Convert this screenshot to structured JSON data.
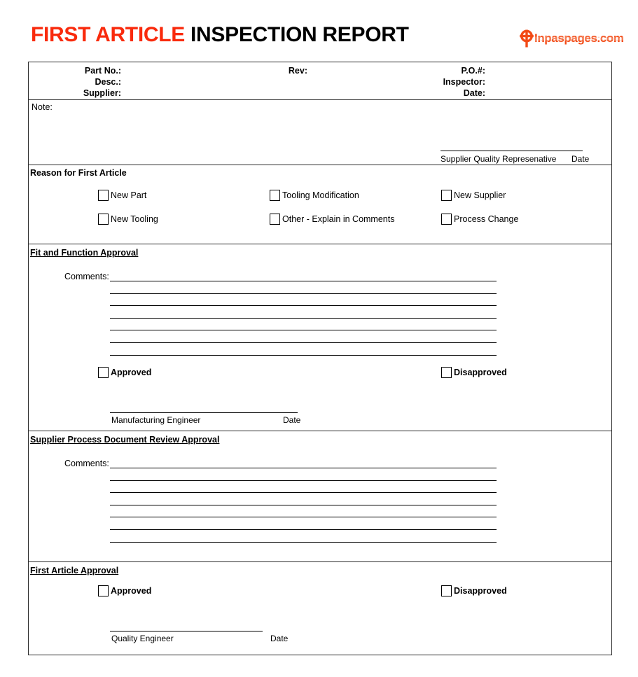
{
  "document": {
    "title_accent": "FIRST ARTICLE",
    "title_plain": " INSPECTION REPORT"
  },
  "logo": {
    "text": "Inpaspages.com",
    "mark": "celtic-cross-icon",
    "color": "#f24a16"
  },
  "header": {
    "fields": [
      {
        "label": "Part No.:"
      },
      {
        "label": "Rev:"
      },
      {
        "label": "P.O.#:"
      },
      {
        "label": "Desc.:"
      },
      {
        "label": "Inspector:"
      },
      {
        "label": "Supplier:"
      },
      {
        "label": "Date:"
      }
    ],
    "part_no": "Part No.:",
    "rev": "Rev:",
    "po": "P.O.#:",
    "desc": "Desc.:",
    "inspector": "Inspector:",
    "supplier": "Supplier:",
    "date": "Date:"
  },
  "note": {
    "label": "Note:",
    "signature_label": "Supplier Quality Represenative",
    "date_label": "Date"
  },
  "reason": {
    "title": "Reason for First Article",
    "options": [
      {
        "label": "New Part",
        "checked": false
      },
      {
        "label": "Tooling Modification",
        "checked": false
      },
      {
        "label": "New Supplier",
        "checked": false
      },
      {
        "label": "New Tooling",
        "checked": false
      },
      {
        "label": "Other - Explain in Comments",
        "checked": false
      },
      {
        "label": "Process Change",
        "checked": false
      }
    ]
  },
  "fit_function": {
    "title": "Fit and Function Approval",
    "comments_label": "Comments:",
    "comment_lines": 7,
    "approved_label": "Approved",
    "disapproved_label": "Disapproved",
    "approved_checked": false,
    "disapproved_checked": false,
    "signature_label": "Manufacturing Engineer",
    "date_label": "Date"
  },
  "supplier_process": {
    "title": "Supplier Process Document Review Approval",
    "comments_label": "Comments:",
    "comment_lines": 7
  },
  "first_article_approval": {
    "title": "First Article Approval",
    "approved_label": "Approved",
    "disapproved_label": "Disapproved",
    "approved_checked": false,
    "disapproved_checked": false,
    "signature_label": "Quality Engineer",
    "date_label": "Date"
  },
  "colors": {
    "accent": "#f92a0c",
    "logo": "#f24a16",
    "border": "#2b2b2b",
    "text": "#000000"
  }
}
